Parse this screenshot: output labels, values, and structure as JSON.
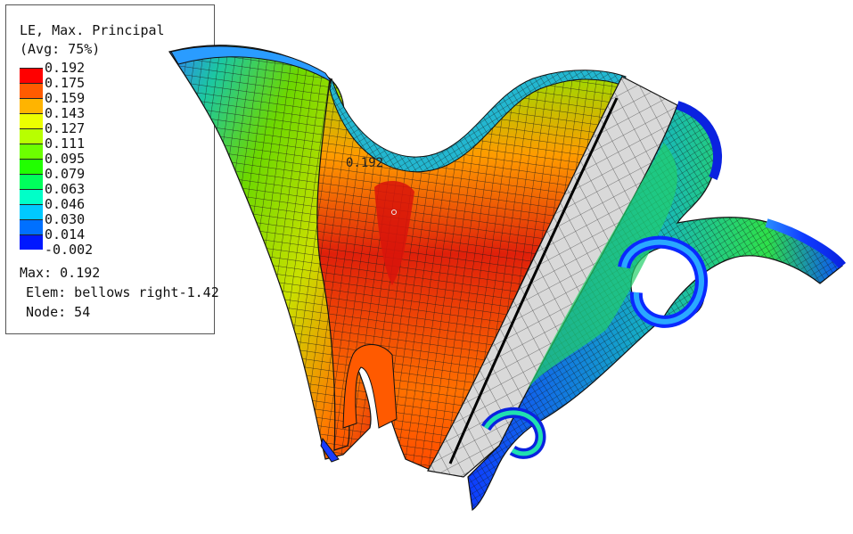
{
  "legend": {
    "title": "LE, Max. Principal",
    "avg": "(Avg: 75%)",
    "ticks": [
      "0.192",
      "0.175",
      "0.159",
      "0.143",
      "0.127",
      "0.111",
      "0.095",
      "0.079",
      "0.063",
      "0.046",
      "0.030",
      "0.014",
      "-0.002"
    ],
    "colors": [
      "#ff0000",
      "#ff5b00",
      "#ffb400",
      "#ecff00",
      "#b8ff00",
      "#6cff00",
      "#21ff00",
      "#00ff5c",
      "#00ffc8",
      "#00c9ff",
      "#0070ff",
      "#0018ff"
    ],
    "max_line": "Max: 0.192",
    "elem_line": "Elem: bellows right-1.42",
    "node_line": "Node: 54"
  },
  "viewport": {
    "max_marker_label": "0.192"
  }
}
